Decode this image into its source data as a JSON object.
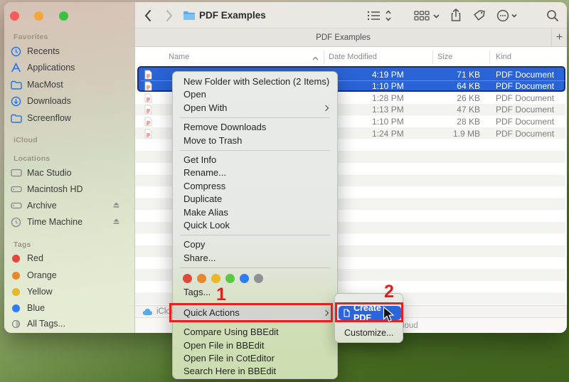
{
  "colors": {
    "accent_blue": "#2a63d5",
    "selection_border": "#1e2f6d",
    "annotation_red": "#e62020",
    "desktop_green": "#44671f",
    "tag_red": "#e2463d",
    "tag_orange": "#e8872c",
    "tag_yellow": "#e9b824",
    "tag_green": "#59c93f",
    "tag_blue": "#2e7cf6",
    "tag_gray": "#909095"
  },
  "toolbar": {
    "title": "PDF Examples"
  },
  "tab_bar": {
    "tab_title": "PDF Examples",
    "new_tab": "+"
  },
  "sidebar": {
    "sections": [
      {
        "label": "Favorites",
        "items": [
          {
            "label": "Recents"
          },
          {
            "label": "Applications"
          },
          {
            "label": "MacMost"
          },
          {
            "label": "Downloads"
          },
          {
            "label": "Screenflow"
          }
        ]
      },
      {
        "label": "iCloud",
        "items": []
      },
      {
        "label": "Locations",
        "items": [
          {
            "label": "Mac Studio"
          },
          {
            "label": "Macintosh HD"
          },
          {
            "label": "Archive"
          },
          {
            "label": "Time Machine"
          }
        ]
      },
      {
        "label": "Tags",
        "items": [
          {
            "label": "Red"
          },
          {
            "label": "Orange"
          },
          {
            "label": "Yellow"
          },
          {
            "label": "Blue"
          },
          {
            "label": "All Tags..."
          }
        ]
      }
    ]
  },
  "file_list": {
    "columns": {
      "name": "Name",
      "date": "Date Modified",
      "size": "Size",
      "kind": "Kind"
    },
    "rows": [
      {
        "date": "4:19 PM",
        "size": "71 KB",
        "kind": "PDF Document",
        "selected": true
      },
      {
        "date": "1:10 PM",
        "size": "64 KB",
        "kind": "PDF Document",
        "selected": true
      },
      {
        "date": "1:28 PM",
        "size": "26 KB",
        "kind": "PDF Document",
        "selected": false
      },
      {
        "date": "1:13 PM",
        "size": "47 KB",
        "kind": "PDF Document",
        "selected": false
      },
      {
        "date": "1:10 PM",
        "size": "28 KB",
        "kind": "PDF Document",
        "selected": false
      },
      {
        "date": "1:24 PM",
        "size": "1.9 MB",
        "kind": "PDF Document",
        "selected": false
      }
    ]
  },
  "status_bar": {
    "icloud": "iCloud",
    "available_fragment": "loud"
  },
  "context_menu": {
    "new_folder": "New Folder with Selection (2 Items)",
    "open": "Open",
    "open_with": "Open With",
    "remove_downloads": "Remove Downloads",
    "move_to_trash": "Move to Trash",
    "get_info": "Get Info",
    "rename": "Rename...",
    "compress": "Compress",
    "duplicate": "Duplicate",
    "make_alias": "Make Alias",
    "quick_look": "Quick Look",
    "copy": "Copy",
    "share": "Share...",
    "tags": "Tags...",
    "quick_actions": "Quick Actions",
    "compare_bbedit": "Compare Using BBEdit",
    "open_file_bbedit": "Open File in BBEdit",
    "open_file_coteditor": "Open File in CotEditor",
    "search_here_bbedit": "Search Here in BBEdit"
  },
  "submenu": {
    "create_pdf": "Create PDF",
    "customize": "Customize..."
  },
  "annotations": {
    "step_1": "1",
    "step_2": "2"
  }
}
